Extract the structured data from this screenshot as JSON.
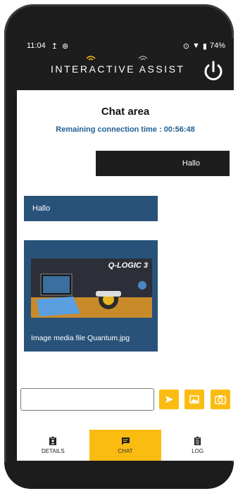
{
  "status_bar": {
    "time": "11:04",
    "battery": "74%"
  },
  "header": {
    "brand": "INTERACTIVE ASSIST"
  },
  "chat": {
    "title": "Chat area",
    "remaining_label": "Remaining connection time",
    "remaining_value": ": 00:56:48",
    "messages": [
      {
        "side": "sent",
        "text": "Hallo"
      },
      {
        "side": "received",
        "text": "Hallo"
      },
      {
        "side": "received",
        "type": "image",
        "caption": "Image media file Quantum.jpg",
        "image_brand": "Q-LOGIC 3"
      }
    ]
  },
  "composer": {
    "value": "",
    "placeholder": ""
  },
  "tabs": [
    {
      "label": "DETAILS",
      "icon": "clipboard-person-icon",
      "active": false
    },
    {
      "label": "CHAT",
      "icon": "chat-bubble-icon",
      "active": true
    },
    {
      "label": "LOG",
      "icon": "document-icon",
      "active": false
    }
  ],
  "colors": {
    "accent": "#fbbc12",
    "header": "#1d1d1d",
    "received_bubble": "#285279",
    "time_text": "#1f5f93"
  }
}
